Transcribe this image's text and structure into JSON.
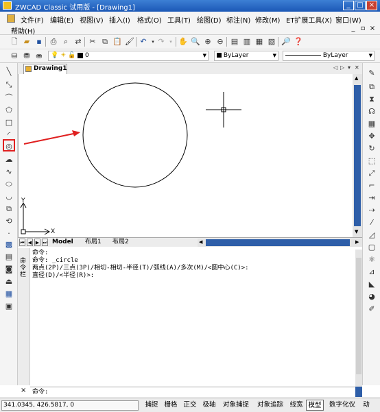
{
  "window": {
    "title": "ZWCAD Classic 试用版 - [Drawing1]"
  },
  "menu": {
    "items": [
      "文件(F)",
      "编辑(E)",
      "视图(V)",
      "插入(I)",
      "格式(O)",
      "工具(T)",
      "绘图(D)",
      "标注(N)",
      "修改(M)",
      "ET扩展工具(X)",
      "窗口(W)"
    ],
    "help": "帮助(H)"
  },
  "toolbar": {
    "layer_value": "0",
    "color_value": "ByLayer",
    "linetype_value": "ByLayer"
  },
  "drawing_tab": {
    "label": "Drawing1"
  },
  "axes": {
    "x_label": "X",
    "y_label": "Y"
  },
  "layout_tabs": [
    "Model",
    "布局1",
    "布局2"
  ],
  "grip_label": "命令栏",
  "command_history": [
    "命令:",
    "命令: _circle",
    "两点(2P)/三点(3P)/相切-相切-半径(T)/弧线(A)/多次(M)/<圆中心(C)>:",
    "直径(D)/<半径(R)>:"
  ],
  "command_prompt": "命令:",
  "status": {
    "coords": "341.0345,  426.5817,  0",
    "buttons": [
      "捕捉",
      "栅格",
      "正交",
      "极轴",
      "对象捕捉",
      "对象追踪",
      "线宽",
      "模型",
      "数字化仪",
      "动"
    ]
  },
  "colors": {
    "title_bar": "#1c58b6",
    "scroll_thumb": "#2e5ea8",
    "highlight": "#e02020"
  },
  "icons": {
    "left_toolbar": [
      "line-icon",
      "construction-line-icon",
      "polyline-icon",
      "polygon-icon",
      "rectangle-icon",
      "arc-icon",
      "circle-icon",
      "revision-cloud-icon",
      "spline-icon",
      "ellipse-icon",
      "ellipse-arc-icon",
      "insert-block-icon",
      "make-block-icon",
      "point-icon",
      "hatch-icon",
      "region-icon",
      "table-icon",
      "mtext-icon"
    ]
  }
}
